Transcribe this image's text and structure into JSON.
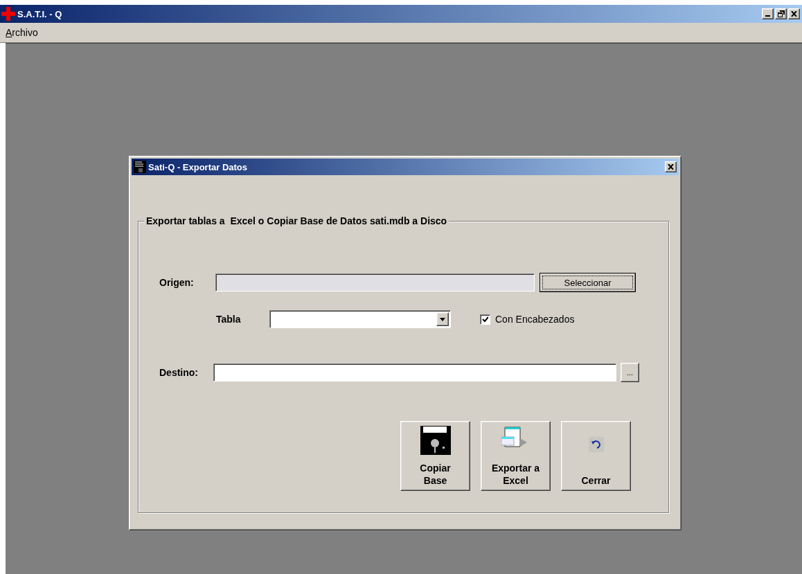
{
  "app": {
    "title": "S.A.T.I. - Q",
    "menu": [
      "Archivo"
    ]
  },
  "dialog": {
    "title": "Sati-Q - Exportar Datos",
    "group_title": "Exportar tablas a  Excel o Copiar Base de Datos sati.mdb a Disco",
    "origin": {
      "label": "Origen:",
      "disabled": true
    },
    "select_button": {
      "label": "Seleccionar",
      "focused": true
    },
    "table": {
      "label": "Tabla"
    },
    "headers_checkbox": {
      "label": "Con Encabezados",
      "checked": true
    },
    "destination": {
      "label": "Destino:",
      "disabled": false
    },
    "browse_button": {
      "label": "..."
    },
    "actions": [
      {
        "kind": "floppy",
        "lines": [
          "Copiar",
          "Base"
        ]
      },
      {
        "kind": "export",
        "lines": [
          "Exportar a",
          "Excel"
        ]
      },
      {
        "kind": "undo",
        "lines": [
          "Cerrar"
        ]
      }
    ]
  }
}
